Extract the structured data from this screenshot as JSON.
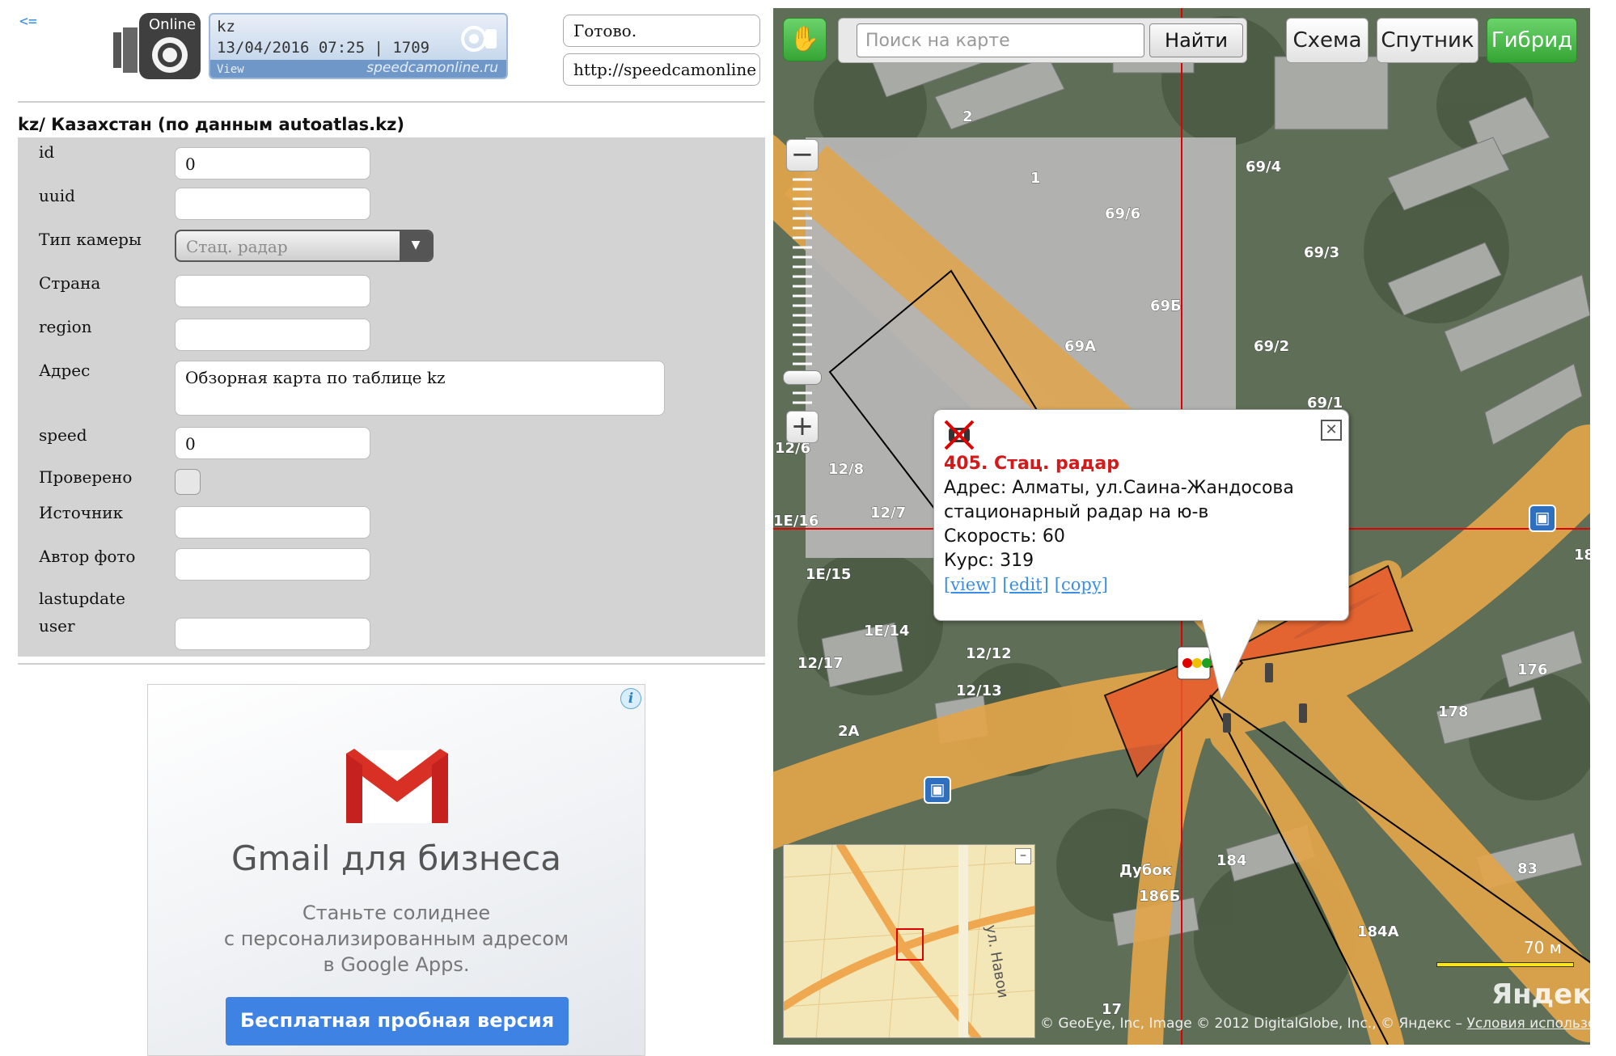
{
  "header": {
    "back_link": "<=",
    "logo_camera_text": "Online",
    "banner": {
      "line1": "kz",
      "line2": "13/04/2016 07:25 | 1709",
      "view": "View",
      "site": "speedcamonline.ru"
    },
    "status_text": "Готово.",
    "status_url": "http://speedcamonline"
  },
  "section_title": "kz/ Казахстан (по данным autoatlas.kz)",
  "form": {
    "fields": {
      "id": {
        "label": "id",
        "value": "0"
      },
      "uuid": {
        "label": "uuid",
        "value": ""
      },
      "camera_type": {
        "label": "Тип камеры",
        "value": "Стац. радар"
      },
      "country": {
        "label": "Страна",
        "value": ""
      },
      "region": {
        "label": "region",
        "value": ""
      },
      "address": {
        "label": "Адрес",
        "value": "Обзорная карта по таблице kz"
      },
      "speed": {
        "label": "speed",
        "value": "0"
      },
      "verified": {
        "label": "Проверено",
        "checked": false
      },
      "source": {
        "label": "Источник",
        "value": ""
      },
      "photo_author": {
        "label": "Автор фото",
        "value": ""
      },
      "lastupdate": {
        "label": "lastupdate",
        "value": ""
      },
      "user": {
        "label": "user",
        "value": ""
      }
    }
  },
  "ad": {
    "title": "Gmail для бизнеса",
    "line1": "Станьте солиднее",
    "line2": "с персонализированным адресом",
    "line3": "в Google Apps.",
    "cta": "Бесплатная пробная версия",
    "info_icon": "info-icon"
  },
  "map": {
    "search_placeholder": "Поиск на карте",
    "search_button": "Найти",
    "map_types": {
      "scheme": "Схема",
      "satellite": "Спутник",
      "hybrid": "Гибрид"
    },
    "active_map_type": "hybrid",
    "zoom_minus": "−",
    "zoom_plus": "+",
    "balloon": {
      "title": "405. Стац. радар",
      "address": "Адрес: Алматы, ул.Саина-Жандосова",
      "description": "стационарный радар на ю-в",
      "speed": "Скорость: 60",
      "course": "Курс: 319",
      "links": [
        "[view]",
        "[edit]",
        "[copy]"
      ]
    },
    "labels": [
      "1",
      "2",
      "69/6",
      "69/4",
      "69/3",
      "69Б",
      "69А",
      "69/2",
      "69/1",
      "12/8",
      "12/7",
      "12/6",
      "1Е/16",
      "1Е/15",
      "1Е/14",
      "12/17",
      "12/12",
      "12/13",
      "2А",
      "176",
      "178",
      "184",
      "186Б",
      "184А",
      "83",
      "18",
      "17"
    ],
    "poi_dubok": "Дубок",
    "minimap_street": "ул. Навои",
    "scale": "70 м",
    "logo": "Яндекс",
    "copyright_text": "© GeoEye, Inc, Image © 2012 DigitalGlobe, Inc., © Яндекс –",
    "copyright_link": "Условия использования",
    "colors": {
      "road": "#e2a54b",
      "grey_overlay": "#b5b5b5",
      "radar_sector": "#e65a2c",
      "crosshair": "#e00000",
      "active_button": "#3fae3f",
      "link": "#3a8ee6",
      "balloon_title": "#d31a1a"
    }
  }
}
